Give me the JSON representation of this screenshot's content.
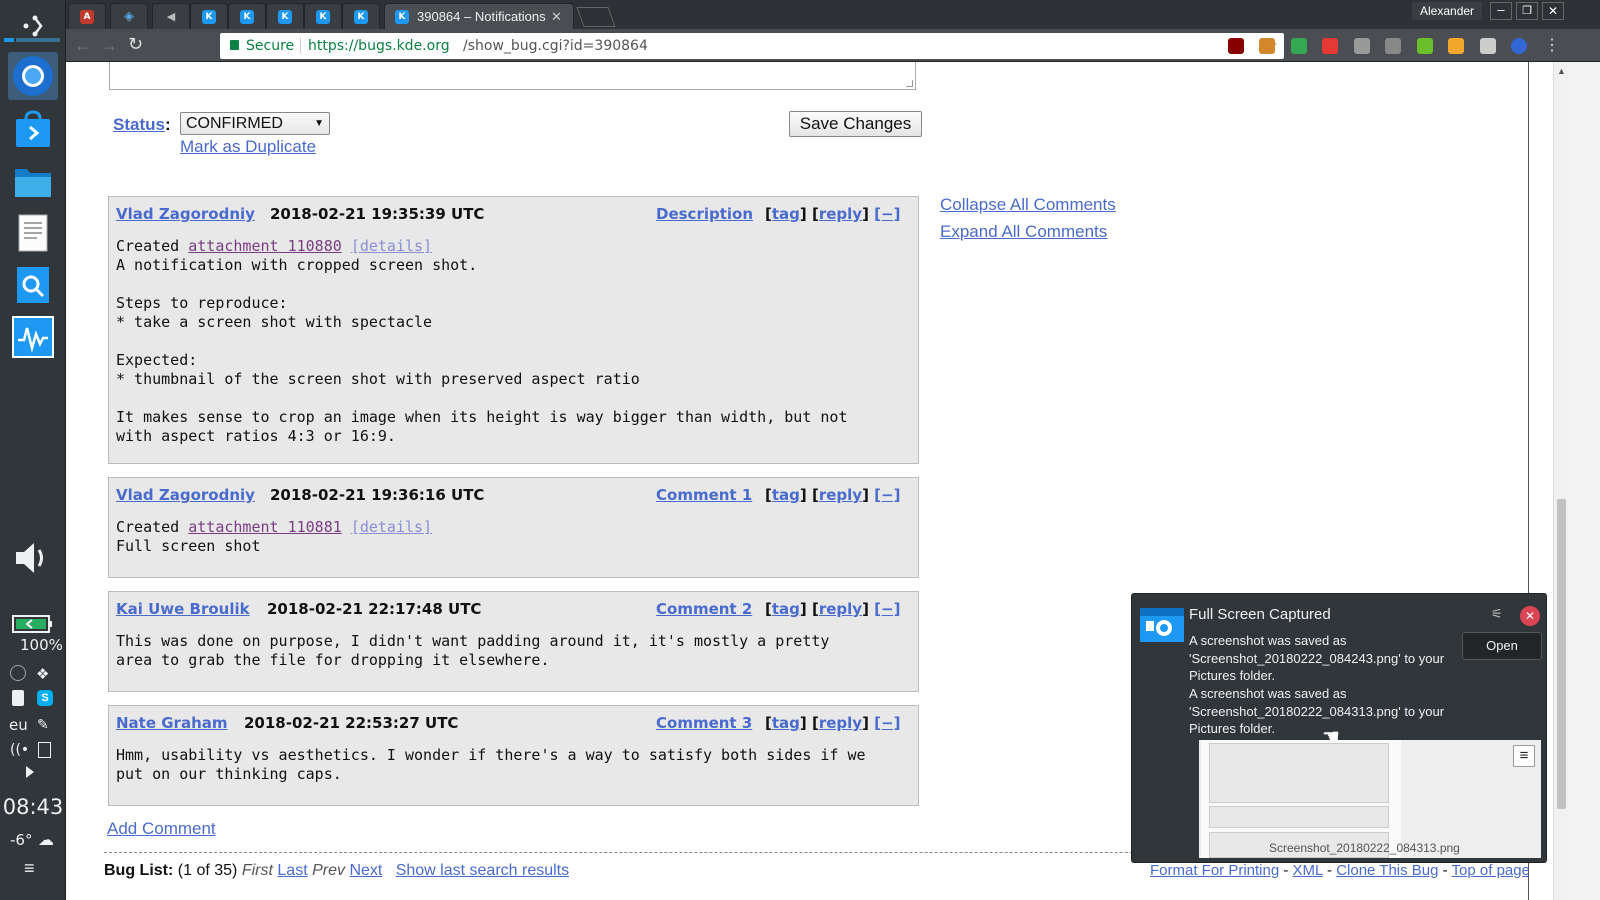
{
  "browser": {
    "active_tab_title": "390864 – Notifications",
    "user": "Alexander",
    "secure_label": "Secure",
    "url_scheme_host": "https://bugs.kde.org",
    "url_path": "/show_bug.cgi?id=390864"
  },
  "panel": {
    "battery": "100%",
    "keyboard_layout": "eu",
    "clock": "08:43",
    "temperature": "-6°"
  },
  "form": {
    "status_label": "Status",
    "status_value": "CONFIRMED",
    "mark_duplicate": "Mark as Duplicate",
    "save_button": "Save Changes"
  },
  "side_links": {
    "collapse_all": "Collapse All Comments",
    "expand_all": "Expand All Comments"
  },
  "comments": [
    {
      "author": "Vlad Zagorodniy",
      "date": "2018-02-21 19:35:39 UTC",
      "label": "Description",
      "created": "Created",
      "attachment": "attachment 110880",
      "details": "[details]",
      "text": "A notification with cropped screen shot.\n\nSteps to reproduce:\n* take a screen shot with spectacle\n\nExpected:\n* thumbnail of the screen shot with preserved aspect ratio\n\nIt makes sense to crop an image when its height is way bigger than width, but not\nwith aspect ratios 4:3 or 16:9."
    },
    {
      "author": "Vlad Zagorodniy",
      "date": "2018-02-21 19:36:16 UTC",
      "label": "Comment 1",
      "created": "Created",
      "attachment": "attachment 110881",
      "details": "[details]",
      "text": "Full screen shot"
    },
    {
      "author": "Kai Uwe Broulik",
      "date": "2018-02-21 22:17:48 UTC",
      "label": "Comment 2",
      "text": "This was done on purpose, I didn't want padding around it, it's mostly a pretty\narea to grab the file for dropping it elsewhere."
    },
    {
      "author": "Nate Graham",
      "date": "2018-02-21 22:53:27 UTC",
      "label": "Comment 3",
      "text": "Hmm, usability vs aesthetics. I wonder if there's a way to satisfy both sides if we\nput on our thinking caps."
    }
  ],
  "comment_actions": {
    "tag": "tag",
    "reply": "reply",
    "collapse": "[−]"
  },
  "add_comment": "Add Comment",
  "bug_list": {
    "label": "Bug List:",
    "count": "(1 of 35)",
    "first": "First",
    "last": "Last",
    "prev": "Prev",
    "next": "Next",
    "show_last": "Show last search results"
  },
  "footer_links": {
    "format_printing": "Format For Printing",
    "xml": "XML",
    "clone": "Clone This Bug",
    "top": "Top of page"
  },
  "notification": {
    "title": "Full Screen Captured",
    "open_button": "Open",
    "line1": "A screenshot was saved as",
    "line2": "'Screenshot_20180222_084243.png' to your",
    "line3": "Pictures folder.",
    "line4": "A screenshot was saved as",
    "line5": "'Screenshot_20180222_084313.png' to your",
    "line6": "Pictures folder.",
    "thumbnail_caption": "Screenshot_20180222_084313.png"
  },
  "colors": {
    "link": "#4a6bce",
    "panel_bg": "#31363b",
    "comment_bg": "#e8e8e8",
    "breeze_blue": "#1d99f3"
  }
}
